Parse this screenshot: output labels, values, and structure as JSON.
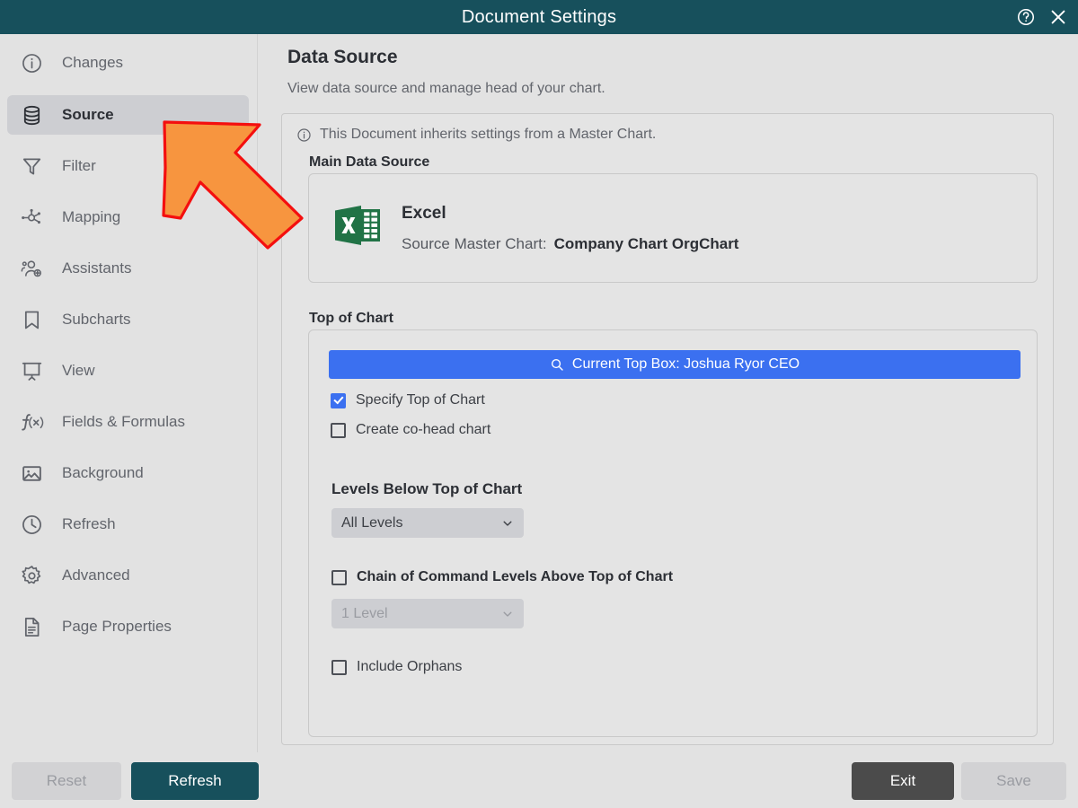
{
  "window": {
    "title": "Document Settings",
    "help_icon": "help-circle-icon",
    "close_icon": "close-icon"
  },
  "sidebar": {
    "items": [
      {
        "label": "Changes",
        "icon": "info-circle-icon",
        "selected": false
      },
      {
        "label": "Source",
        "icon": "database-icon",
        "selected": true
      },
      {
        "label": "Filter",
        "icon": "funnel-icon",
        "selected": false
      },
      {
        "label": "Mapping",
        "icon": "node-graph-icon",
        "selected": false
      },
      {
        "label": "Assistants",
        "icon": "people-add-icon",
        "selected": false
      },
      {
        "label": "Subcharts",
        "icon": "bookmark-icon",
        "selected": false
      },
      {
        "label": "View",
        "icon": "presentation-icon",
        "selected": false
      },
      {
        "label": "Fields & Formulas",
        "icon": "function-icon",
        "selected": false
      },
      {
        "label": "Background",
        "icon": "image-icon",
        "selected": false
      },
      {
        "label": "Refresh",
        "icon": "clock-icon",
        "selected": false
      },
      {
        "label": "Advanced",
        "icon": "gear-icon",
        "selected": false
      },
      {
        "label": "Page Properties",
        "icon": "document-icon",
        "selected": false
      }
    ]
  },
  "main": {
    "title": "Data Source",
    "subtitle": "View data source and manage head of your chart.",
    "info_banner": {
      "icon": "info-circle-icon",
      "text": "This Document inherits settings from a Master Chart."
    },
    "data_source": {
      "section_label": "Main Data Source",
      "icon": "excel-icon",
      "name": "Excel",
      "master_chart_label": "Source Master Chart:",
      "master_chart_value": "Company Chart OrgChart"
    },
    "top_of_chart": {
      "section_label": "Top of Chart",
      "top_box_button": {
        "icon": "search-icon",
        "label": "Current Top Box: Joshua Ryor CEO"
      },
      "checkbox_specify": {
        "label": "Specify Top of Chart",
        "checked": true
      },
      "checkbox_cohead": {
        "label": "Create co-head chart",
        "checked": false
      },
      "levels_below_label": "Levels Below Top of Chart",
      "levels_below_value": "All Levels",
      "checkbox_chain": {
        "label": "Chain of Command Levels Above Top of Chart",
        "checked": false
      },
      "chain_levels_value": "1 Level",
      "checkbox_orphans": {
        "label": "Include Orphans",
        "checked": false
      }
    }
  },
  "footer": {
    "reset_label": "Reset",
    "refresh_label": "Refresh",
    "exit_label": "Exit",
    "save_label": "Save"
  },
  "colors": {
    "titlebar": "#17505c",
    "accent_blue": "#3b70f0",
    "excel_green": "#217346",
    "annotation_fill": "#f7953f",
    "annotation_stroke": "#f40f0f",
    "background": "#e2e2e2",
    "selected_row": "#cdced2"
  }
}
